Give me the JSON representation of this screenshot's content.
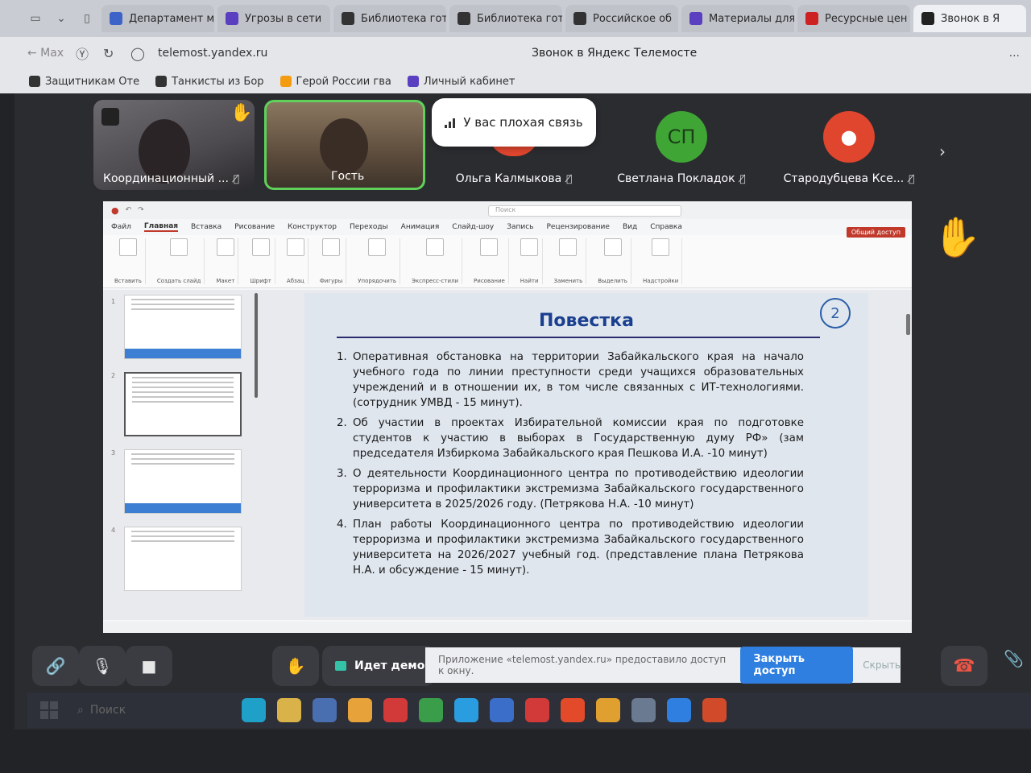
{
  "tabs": [
    {
      "label": "Департамент м",
      "icon": "uc-icon",
      "color": "#3d63c9"
    },
    {
      "label": "Угрозы в сети",
      "icon": "bookmark-icon",
      "color": "#5a3fc0"
    },
    {
      "label": "Библиотека гот",
      "icon": "z-icon",
      "color": "#333333"
    },
    {
      "label": "Библиотека гот",
      "icon": "z-icon",
      "color": "#333333"
    },
    {
      "label": "Российское об",
      "icon": "z-icon",
      "color": "#333333"
    },
    {
      "label": "Материалы для",
      "icon": "bookmark-icon",
      "color": "#5a3fc0"
    },
    {
      "label": "Ресурсные цен",
      "icon": "flag-icon",
      "color": "#cc2222"
    },
    {
      "label": "Звонок в Я",
      "icon": "telemost-icon",
      "color": "#222222",
      "active": true
    }
  ],
  "address": {
    "back_label": "← Max",
    "url": "telemost.yandex.ru",
    "page_title": "Звонок в Яндекс Телемосте",
    "more": "..."
  },
  "bookmarks": [
    {
      "label": "Защитникам Оте",
      "color": "#333333"
    },
    {
      "label": "Танкисты из Бор",
      "color": "#333333"
    },
    {
      "label": "Герой России гва",
      "color": "#f39c12"
    },
    {
      "label": "Личный кабинет",
      "color": "#5a3fc0"
    }
  ],
  "participants": [
    {
      "name": "Координационный ...",
      "type": "video"
    },
    {
      "name": "Гость",
      "type": "video",
      "speaking": true
    },
    {
      "name": "Ольга Калмыкова",
      "type": "avatar",
      "color": "#e0452e"
    },
    {
      "name": "Светлана Покладок",
      "type": "avatar",
      "initials": "СП",
      "color": "#3fa535"
    },
    {
      "name": "Стародубцева Ксе...",
      "type": "avatar",
      "color": "#e0452e"
    }
  ],
  "toast": {
    "text": "У вас плохая связь"
  },
  "powerpoint": {
    "search_placeholder": "Поиск",
    "share_label": "Общий доступ",
    "menu": [
      "Файл",
      "Главная",
      "Вставка",
      "Рисование",
      "Конструктор",
      "Переходы",
      "Анимация",
      "Слайд-шоу",
      "Запись",
      "Рецензирование",
      "Вид",
      "Справка"
    ],
    "ribbon": [
      "Вставить",
      "Создать слайд",
      "Макет",
      "Шрифт",
      "Абзац",
      "Фигуры",
      "Упорядочить",
      "Экспресс-стили",
      "Рисование",
      "Найти",
      "Заменить",
      "Выделить",
      "Надстройки"
    ]
  },
  "slide": {
    "number": "2",
    "title": "Повестка",
    "items": [
      {
        "n": "1.",
        "text": "Оперативная обстановка на территории Забайкальского края на начало учебного года по линии преступности среди учащихся образовательных учреждений и в отношении их, в том числе связанных с ИТ-технологиями. (сотрудник УМВД - 15 минут)."
      },
      {
        "n": "2.",
        "text": "Об участии в проектах Избирательной комиссии края по подготовке студентов к участию в выборах в Государственную думу РФ» (зам председателя Избиркома Забайкальского края Пешкова И.А. -10 минут)"
      },
      {
        "n": "3.",
        "text": "О деятельности Координационного центра по противодействию идеологии терроризма и профилактики экстремизма Забайкальского государственного университета в 2025/2026 году. (Петрякова Н.А. -10 минут)"
      },
      {
        "n": "4.",
        "text": "План работы Координационного центра по противодействию идеологии терроризма и профилактики экстремизма Забайкальского государственного университета на 2026/2027 учебный год. (представление плана Петрякова Н.А. и обсуждение - 15 минут)."
      }
    ]
  },
  "controls": {
    "demo_label": "Идет демо",
    "notify_text": "Приложение «telemost.yandex.ru» предоставило доступ к окну.",
    "close_access": "Закрыть доступ",
    "hide": "Скрыть"
  },
  "taskbar": {
    "search_placeholder": "Поиск",
    "apps": [
      {
        "icon": "edge-icon",
        "color": "#1fa0c9"
      },
      {
        "icon": "explorer-icon",
        "color": "#d9b24a"
      },
      {
        "icon": "store-icon",
        "color": "#4a6fb0"
      },
      {
        "icon": "search-app-icon",
        "color": "#e8a23a"
      },
      {
        "icon": "pdf-icon",
        "color": "#d23a3a"
      },
      {
        "icon": "chrome-icon",
        "color": "#3a9d4a"
      },
      {
        "icon": "telegram-icon",
        "color": "#2a9de0"
      },
      {
        "icon": "save-icon",
        "color": "#3a6ec9"
      },
      {
        "icon": "opera-icon",
        "color": "#d23a3a"
      },
      {
        "icon": "yandex-icon",
        "color": "#e24a2a"
      },
      {
        "icon": "yandex-browser-icon",
        "color": "#e0a030"
      },
      {
        "icon": "circle-app-icon",
        "color": "#6a7a90"
      },
      {
        "icon": "windows-icon",
        "color": "#2f7fe0"
      },
      {
        "icon": "powerpoint-icon",
        "color": "#d14a2a"
      }
    ]
  }
}
